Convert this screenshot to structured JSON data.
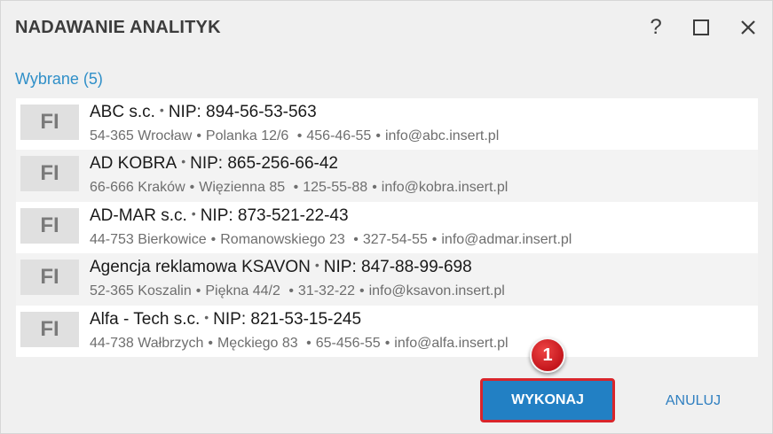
{
  "dialog": {
    "title": "NADAWANIE ANALITYK",
    "help_label": "?",
    "section_label": "Wybrane (5)"
  },
  "items": [
    {
      "badge": "FI",
      "name": "ABC s.c.",
      "nip": "NIP: 894-56-53-563",
      "address": "54-365 Wrocław",
      "street": "Polanka  12/6",
      "phone": "456-46-55",
      "email": "info@abc.insert.pl"
    },
    {
      "badge": "FI",
      "name": "AD KOBRA",
      "nip": "NIP: 865-256-66-42",
      "address": "66-666 Kraków",
      "street": "Więzienna  85",
      "phone": "125-55-88",
      "email": "info@kobra.insert.pl"
    },
    {
      "badge": "FI",
      "name": "AD-MAR s.c.",
      "nip": "NIP: 873-521-22-43",
      "address": "44-753 Bierkowice",
      "street": "Romanowskiego 23",
      "phone": "327-54-55",
      "email": "info@admar.insert.pl"
    },
    {
      "badge": "FI",
      "name": "Agencja reklamowa KSAVON",
      "nip": "NIP: 847-88-99-698",
      "address": "52-365 Koszalin",
      "street": "Piękna  44/2",
      "phone": "31-32-22",
      "email": "info@ksavon.insert.pl"
    },
    {
      "badge": "FI",
      "name": "Alfa - Tech s.c.",
      "nip": "NIP: 821-53-15-245",
      "address": "44-738 Wałbrzych",
      "street": "Męckiego  83",
      "phone": "65-456-55",
      "email": "info@alfa.insert.pl"
    }
  ],
  "marker": {
    "label": "1"
  },
  "actions": {
    "ok_label": "WYKONAJ",
    "cancel_label": "ANULUJ"
  },
  "colors": {
    "accent": "#2280c4",
    "highlight": "#d9252b",
    "section_label": "#2f8fc8"
  },
  "icons": {
    "help": "help-icon",
    "maximize": "maximize-icon",
    "close": "close-icon"
  }
}
